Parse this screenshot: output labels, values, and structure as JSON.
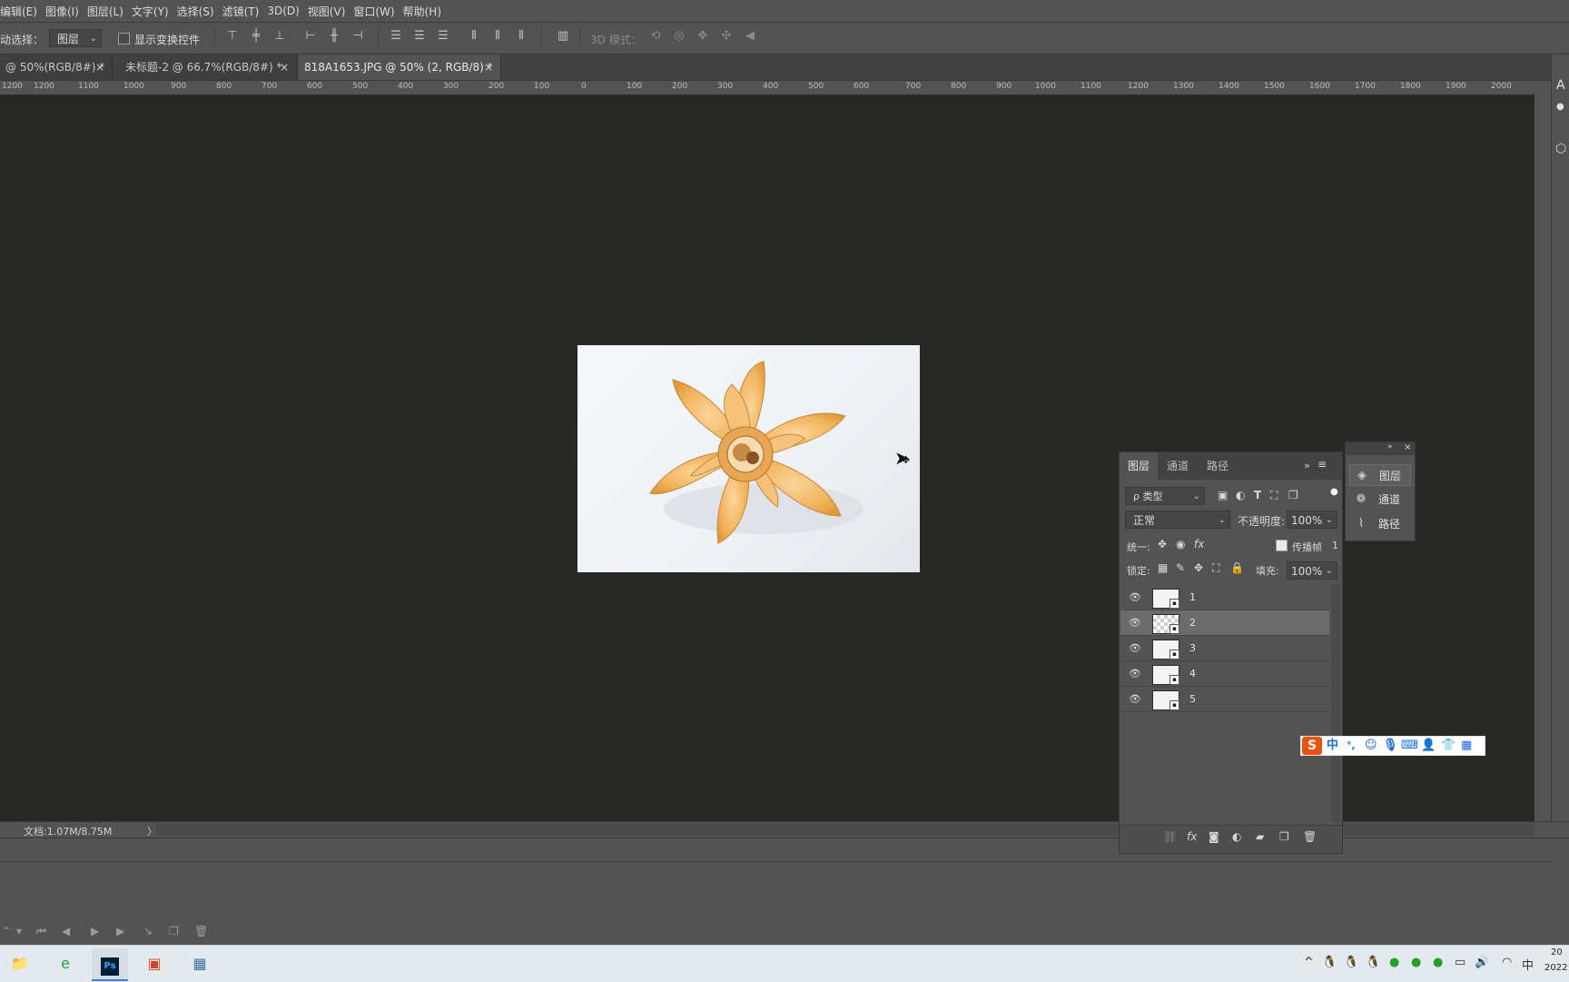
{
  "menu": [
    "编辑(E)",
    "图像(I)",
    "图层(L)",
    "文字(Y)",
    "选择(S)",
    "滤镜(T)",
    "3D(D)",
    "视图(V)",
    "窗口(W)",
    "帮助(H)"
  ],
  "options": {
    "auto_select_label": "动选择：",
    "auto_select_value": "图层",
    "show_transform_label": "显示变换控件",
    "mode_3d_label": "3D 模式："
  },
  "tabs": [
    {
      "label": "@ 50%(RGB/8#) *"
    },
    {
      "label": "未标题-2 @ 66.7%(RGB/8#) *"
    },
    {
      "label": "818A1653.JPG @ 50% (2, RGB/8) *"
    }
  ],
  "ruler": [
    "1200",
    "1100",
    "1000",
    "900",
    "800",
    "700",
    "600",
    "500",
    "400",
    "300",
    "200",
    "100",
    "0",
    "100",
    "200",
    "300",
    "400",
    "500",
    "600",
    "700",
    "800",
    "900",
    "1000",
    "1100",
    "1200",
    "1300",
    "1400",
    "1500",
    "1600",
    "1700",
    "1800",
    "1900",
    "2000"
  ],
  "status": {
    "doc_info": "文档:1.07M/8.75M",
    "arrow": "〉"
  },
  "layers_panel": {
    "tabs": [
      "图层",
      "通道",
      "路径"
    ],
    "filter_label": "ρ 类型",
    "blend_mode": "正常",
    "opacity_label": "不透明度:",
    "opacity_value": "100%",
    "unify_label": "统一:",
    "propagate_label": "传播帧",
    "propagate_value": "1",
    "lock_label": "锁定:",
    "fill_label": "填充:",
    "fill_value": "100%",
    "layers": [
      {
        "name": "1",
        "selected": false
      },
      {
        "name": "2",
        "selected": true
      },
      {
        "name": "3",
        "selected": false
      },
      {
        "name": "4",
        "selected": false
      },
      {
        "name": "5",
        "selected": false
      }
    ]
  },
  "mini_panel": {
    "items": [
      "图层",
      "通道",
      "路径"
    ]
  },
  "ime": {
    "brand": "S",
    "lang": "中",
    "punct": "°,"
  },
  "right_strip": {
    "top_letter": "A"
  },
  "taskbar": {
    "clock_line1": "20",
    "clock_line2": "2022",
    "ime_indicator": "中"
  },
  "colors": {
    "accent": "#1a6ad9",
    "canvas": "#282927",
    "ui": "#535353",
    "selected_layer": "#6b6b6b"
  }
}
